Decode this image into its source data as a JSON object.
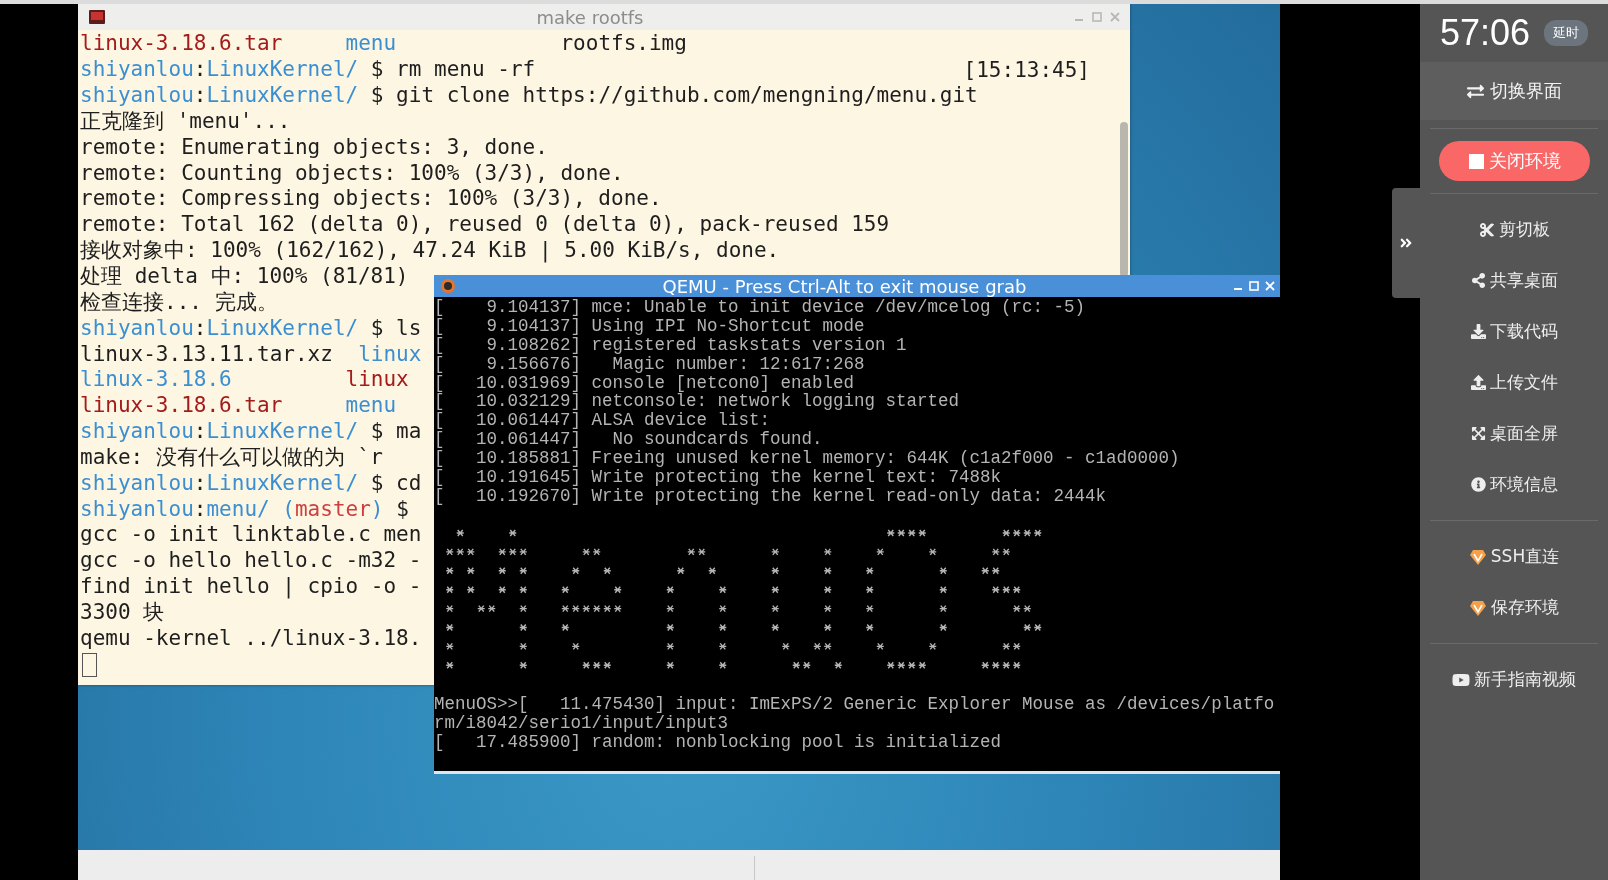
{
  "terminal": {
    "title": "make rootfs",
    "lines": [
      {
        "segments": [
          {
            "text": "linux-3.18.6.tar",
            "kind": "archive"
          },
          {
            "text": "     menu",
            "kind": "dir"
          },
          {
            "text": "             rootfs.img",
            "kind": "plain"
          }
        ]
      },
      {
        "segments": [
          {
            "text": "shiyanlou",
            "kind": "dir"
          },
          {
            "text": ":",
            "kind": "plain"
          },
          {
            "text": "LinuxKernel/",
            "kind": "dir"
          },
          {
            "text": " $ rm menu -rf",
            "kind": "plain"
          }
        ],
        "timestamp": "[15:13:45]"
      },
      {
        "segments": [
          {
            "text": "shiyanlou",
            "kind": "dir"
          },
          {
            "text": ":",
            "kind": "plain"
          },
          {
            "text": "LinuxKernel/",
            "kind": "dir"
          },
          {
            "text": " $ git clone https://github.com/mengning/menu.git",
            "kind": "plain"
          }
        ]
      },
      {
        "segments": [
          {
            "text": "正克隆到 'menu'...",
            "kind": "plain"
          }
        ]
      },
      {
        "segments": [
          {
            "text": "remote: Enumerating objects: 3, done.",
            "kind": "plain"
          }
        ]
      },
      {
        "segments": [
          {
            "text": "remote: Counting objects: 100% (3/3), done.",
            "kind": "plain"
          }
        ]
      },
      {
        "segments": [
          {
            "text": "remote: Compressing objects: 100% (3/3), done.",
            "kind": "plain"
          }
        ]
      },
      {
        "segments": [
          {
            "text": "remote: Total 162 (delta 0), reused 0 (delta 0), pack-reused 159",
            "kind": "plain"
          }
        ]
      },
      {
        "segments": [
          {
            "text": "接收对象中: 100% (162/162), 47.24 KiB | 5.00 KiB/s, done.",
            "kind": "plain"
          }
        ]
      },
      {
        "segments": [
          {
            "text": "处理 delta 中: 100% (81/81)",
            "kind": "plain"
          }
        ]
      },
      {
        "segments": [
          {
            "text": "检查连接... 完成。",
            "kind": "plain"
          }
        ]
      },
      {
        "segments": [
          {
            "text": "shiyanlou",
            "kind": "dir"
          },
          {
            "text": ":",
            "kind": "plain"
          },
          {
            "text": "LinuxKernel/",
            "kind": "dir"
          },
          {
            "text": " $ ls",
            "kind": "plain"
          }
        ]
      },
      {
        "segments": [
          {
            "text": "linux-3.13.11.tar.xz  ",
            "kind": "plain"
          },
          {
            "text": "linux",
            "kind": "dir"
          }
        ]
      },
      {
        "segments": [
          {
            "text": "linux-3.18.6",
            "kind": "dir"
          },
          {
            "text": "         linux",
            "kind": "archive"
          }
        ]
      },
      {
        "segments": [
          {
            "text": "linux-3.18.6.tar",
            "kind": "archive"
          },
          {
            "text": "     menu",
            "kind": "dir"
          }
        ]
      },
      {
        "segments": [
          {
            "text": "shiyanlou",
            "kind": "dir"
          },
          {
            "text": ":",
            "kind": "plain"
          },
          {
            "text": "LinuxKernel/",
            "kind": "dir"
          },
          {
            "text": " $ ma",
            "kind": "plain"
          }
        ]
      },
      {
        "segments": [
          {
            "text": "make: 没有什么可以做的为 `r",
            "kind": "plain"
          }
        ]
      },
      {
        "segments": [
          {
            "text": "shiyanlou",
            "kind": "dir"
          },
          {
            "text": ":",
            "kind": "plain"
          },
          {
            "text": "LinuxKernel/",
            "kind": "dir"
          },
          {
            "text": " $ cd",
            "kind": "plain"
          }
        ]
      },
      {
        "segments": [
          {
            "text": "shiyanlou",
            "kind": "dir"
          },
          {
            "text": ":",
            "kind": "plain"
          },
          {
            "text": "menu/ (",
            "kind": "dir"
          },
          {
            "text": "master",
            "kind": "branch"
          },
          {
            "text": ")",
            "kind": "dir"
          },
          {
            "text": " $",
            "kind": "plain"
          }
        ]
      },
      {
        "segments": [
          {
            "text": "gcc -o init linktable.c men",
            "kind": "plain"
          }
        ]
      },
      {
        "segments": [
          {
            "text": "gcc -o hello hello.c -m32 -",
            "kind": "plain"
          }
        ]
      },
      {
        "segments": [
          {
            "text": "find init hello | cpio -o -",
            "kind": "plain"
          }
        ]
      },
      {
        "segments": [
          {
            "text": "3300 块",
            "kind": "plain"
          }
        ]
      },
      {
        "segments": [
          {
            "text": "qemu -kernel ../linux-3.18.",
            "kind": "plain"
          }
        ]
      }
    ]
  },
  "qemu": {
    "title": "QEMU - Press Ctrl-Alt to exit mouse grab",
    "lines": [
      "[    9.104137] mce: Unable to init device /dev/mcelog (rc: -5)",
      "[    9.104137] Using IPI No-Shortcut mode",
      "[    9.108262] registered taskstats version 1",
      "[    9.156676]   Magic number: 12:617:268",
      "[   10.031969] console [netcon0] enabled",
      "[   10.032129] netconsole: network logging started",
      "[   10.061447] ALSA device list:",
      "[   10.061447]   No soundcards found.",
      "[   10.185881] Freeing unused kernel memory: 644K (c1a2f000 - c1ad0000)",
      "[   10.191645] Write protecting the kernel text: 7488k",
      "[   10.192670] Write protecting the kernel read-only data: 2444k"
    ],
    "tail": [
      "MenuOS>>[   11.475430] input: ImExPS/2 Generic Explorer Mouse as /devices/platfo",
      "rm/i8042/serio1/input/input3",
      "[   17.485900] random: nonblocking pool is initialized"
    ]
  },
  "sidebar": {
    "timer": "57:06",
    "badge": "延时",
    "switch": "切换界面",
    "close": "关闭环境",
    "groups": [
      [
        "剪切板",
        "共享桌面",
        "下载代码",
        "上传文件",
        "桌面全屏",
        "环境信息"
      ],
      [
        "SSH直连",
        "保存环境"
      ],
      [
        "新手指南视频"
      ]
    ]
  }
}
